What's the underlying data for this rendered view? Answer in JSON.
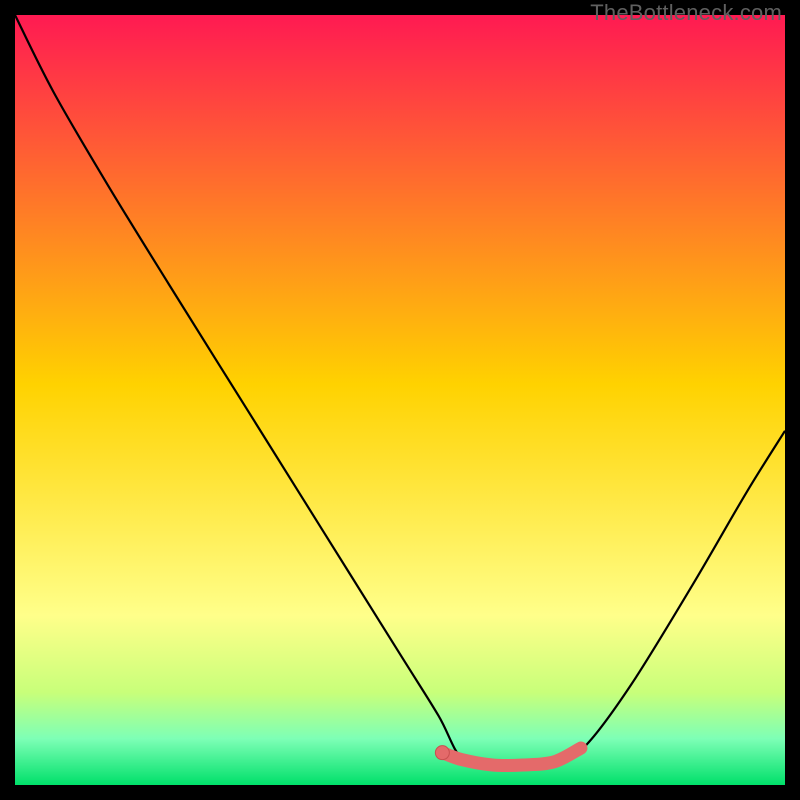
{
  "watermark": "TheBottleneck.com",
  "colors": {
    "top": "#ff1a52",
    "mid": "#ffd200",
    "low": "#ffff8a",
    "green1": "#c8ff7a",
    "green2": "#7dffb6",
    "green3": "#00e06a",
    "curve": "#000000",
    "marker_fill": "#e46a6a",
    "marker_stroke": "#c94f4f"
  },
  "chart_data": {
    "type": "line",
    "title": "",
    "xlabel": "",
    "ylabel": "",
    "xlim": [
      0,
      100
    ],
    "ylim": [
      0,
      100
    ],
    "series": [
      {
        "name": "bottleneck-curve",
        "x": [
          0,
          5,
          12,
          20,
          30,
          40,
          50,
          55,
          58,
          62,
          66,
          70,
          74,
          80,
          88,
          95,
          100
        ],
        "y": [
          100,
          90,
          78,
          65,
          49,
          33,
          17,
          9,
          3.5,
          2.5,
          2.5,
          2.8,
          5,
          13,
          26,
          38,
          46
        ]
      }
    ],
    "highlight_segment": {
      "name": "optimal-range",
      "x": [
        55.5,
        58,
        62,
        66,
        70,
        73.5
      ],
      "y": [
        4.2,
        3.3,
        2.6,
        2.6,
        3.0,
        4.8
      ]
    },
    "marker_point": {
      "x": 55.5,
      "y": 4.2
    }
  }
}
